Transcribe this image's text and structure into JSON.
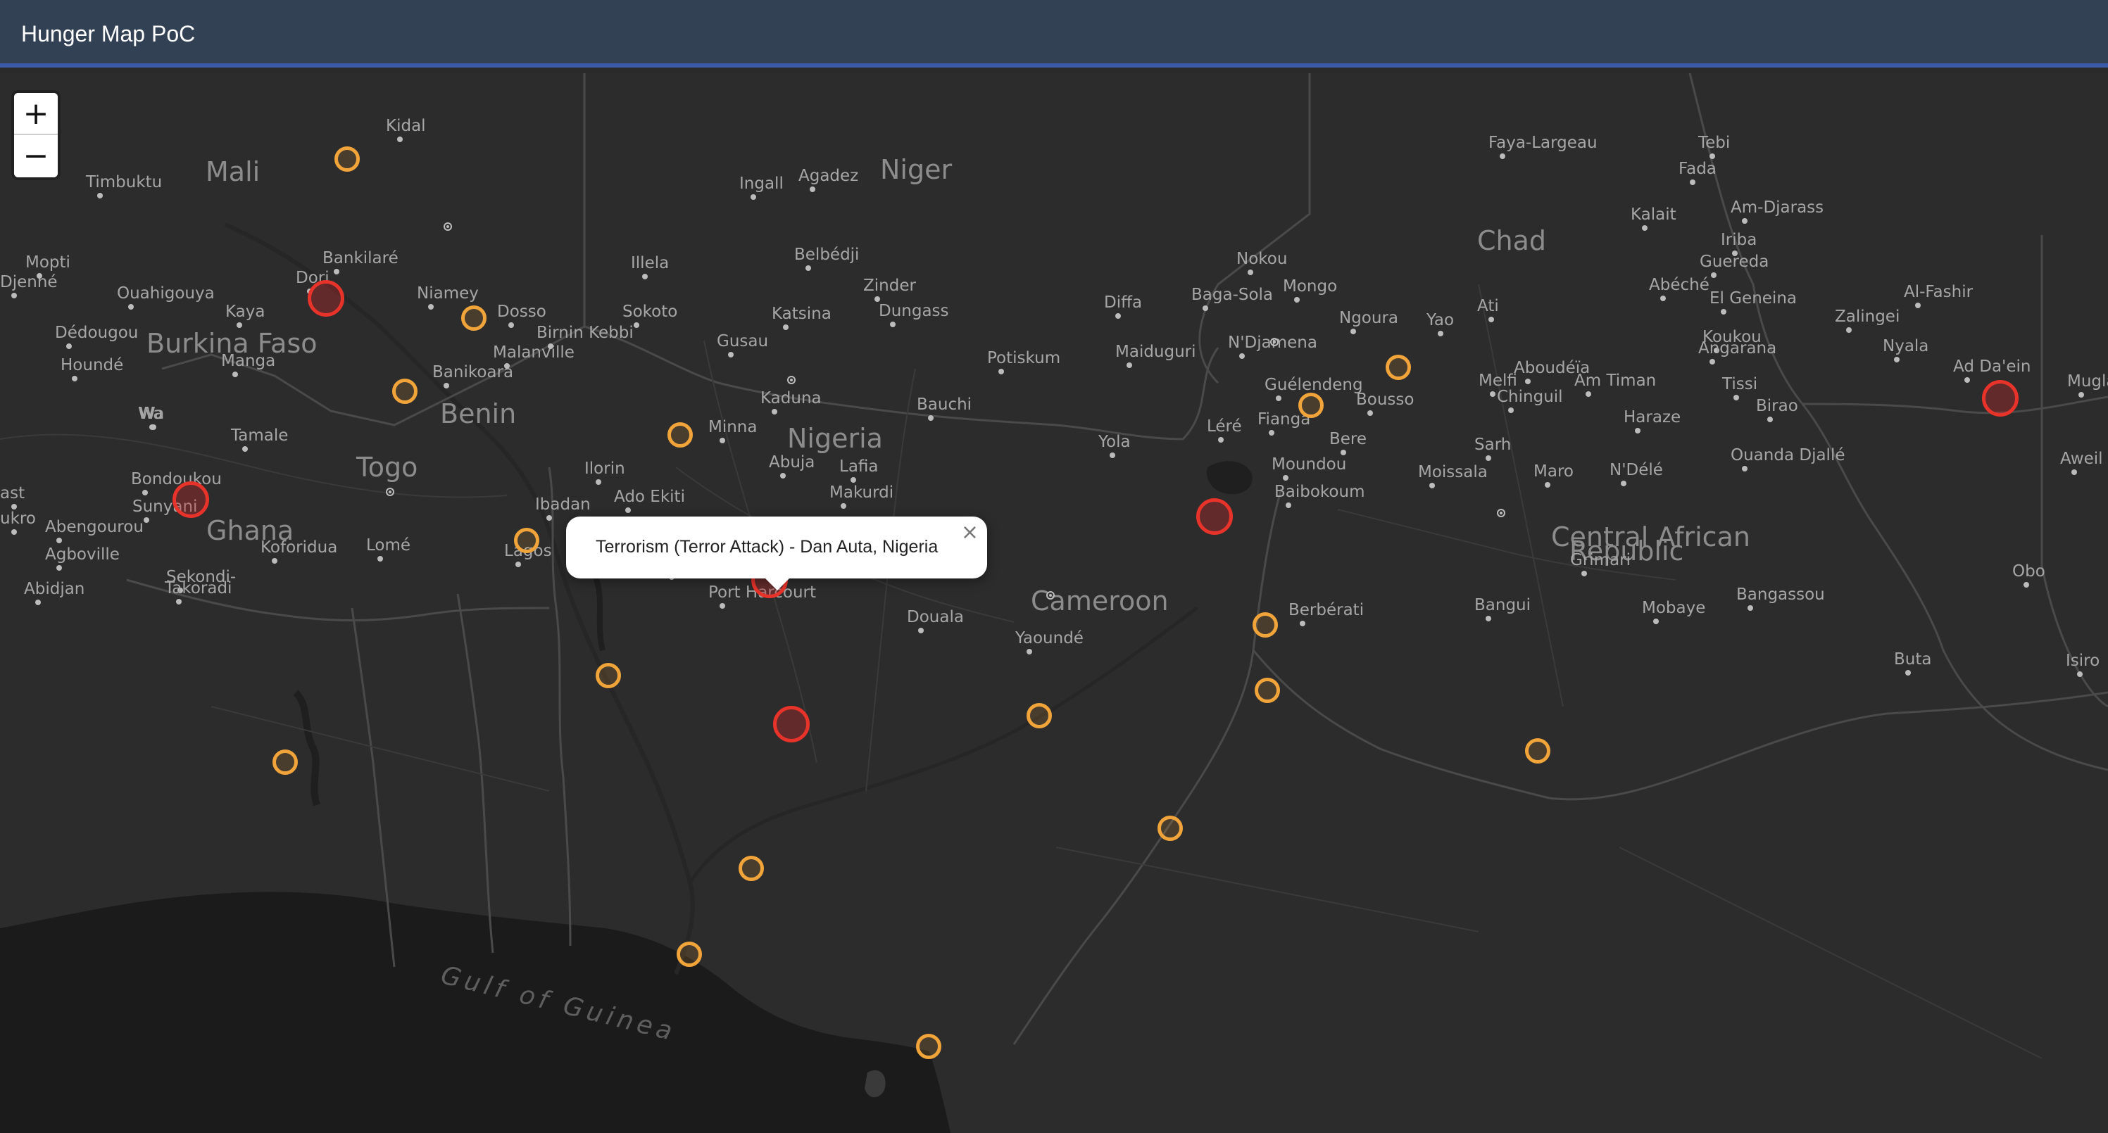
{
  "app": {
    "title": "Hunger Map PoC"
  },
  "zoom": {
    "in_label": "+",
    "out_label": "−"
  },
  "popup": {
    "text": "Terrorism (Terror Attack) - Dan Auta, Nigeria",
    "close_label": "×"
  },
  "colors": {
    "navbar": "#334155",
    "navbar_border": "#3b5ba8",
    "map_land": "#2c2c2c",
    "map_sea": "#1c1c1c",
    "marker_orange": "#f0a43a",
    "marker_red": "#e8332a"
  },
  "labels": {
    "countries": [
      "Mali",
      "Niger",
      "Chad",
      "Burkina Faso",
      "Benin",
      "Togo",
      "Ghana",
      "Nigeria",
      "Cameroon",
      "Central African",
      "Republic"
    ],
    "cities": [
      "Kidal",
      "Timbuktu",
      "Mopti",
      "Djenné",
      "Ouahigouya",
      "Dori",
      "Bankilaré",
      "Niamey",
      "Dosso",
      "Kaya",
      "Dédougou",
      "Manga",
      "Houndé",
      "Banikoara",
      "Malanville",
      "Birnin Kebbi",
      "Sokoto",
      "Illela",
      "Gusau",
      "Katsina",
      "Belbédji",
      "Zinder",
      "Dungass",
      "Diffa",
      "Ingall",
      "Agadez",
      "Nokou",
      "Baga-Sola",
      "Mongo",
      "Ngoura",
      "Yao",
      "Ati",
      "Faya-Largeau",
      "Tebi",
      "Fada",
      "Kalait",
      "Am-Djarass",
      "Iriba",
      "Guereda",
      "Abéché",
      "El Geneina",
      "Al-Fashir",
      "Zalingei",
      "Koukou",
      "Angarana",
      "Nyala",
      "Ad Da'ein",
      "Potiskum",
      "Maiduguri",
      "N'Djamena",
      "Guélendeng",
      "Melfi",
      "Aboudéïa",
      "Am Timan",
      "Tissi",
      "Mugla",
      "Chinguil",
      "Birao",
      "Haraze",
      "Bousso",
      "Fianga",
      "Léré",
      "Bere",
      "Sarh",
      "Ouanda Djallé",
      "Aweil",
      "Moundou",
      "Moissala",
      "Maro",
      "N'Délé",
      "Baibokoum",
      "Kaduna",
      "Bauchi",
      "Minna",
      "Abuja",
      "Lafia",
      "Yola",
      "Makurdi",
      "Ilorin",
      "Wa",
      "Tamale",
      "Bondoukou",
      "Sunyani",
      "Abengourou",
      "Koforidua",
      "Lomé",
      "Agboville",
      "Abidjan",
      "Sekondi-",
      "Takoradi",
      "Lagos",
      "Ibadan",
      "Ado Ekiti",
      "Benin City",
      "Enugu",
      "Warri",
      "Port Harcourt",
      "Douala",
      "Yaoundé",
      "Berbérati",
      "Bangui",
      "Mobaye",
      "Bangassou",
      "Grimari",
      "Obo",
      "Buta",
      "Isiro",
      "ukro",
      "ast",
      "Wa"
    ],
    "seas": [
      "Gulf of Guinea"
    ]
  },
  "markers": {
    "orange_count": 21,
    "red_count": 7
  }
}
